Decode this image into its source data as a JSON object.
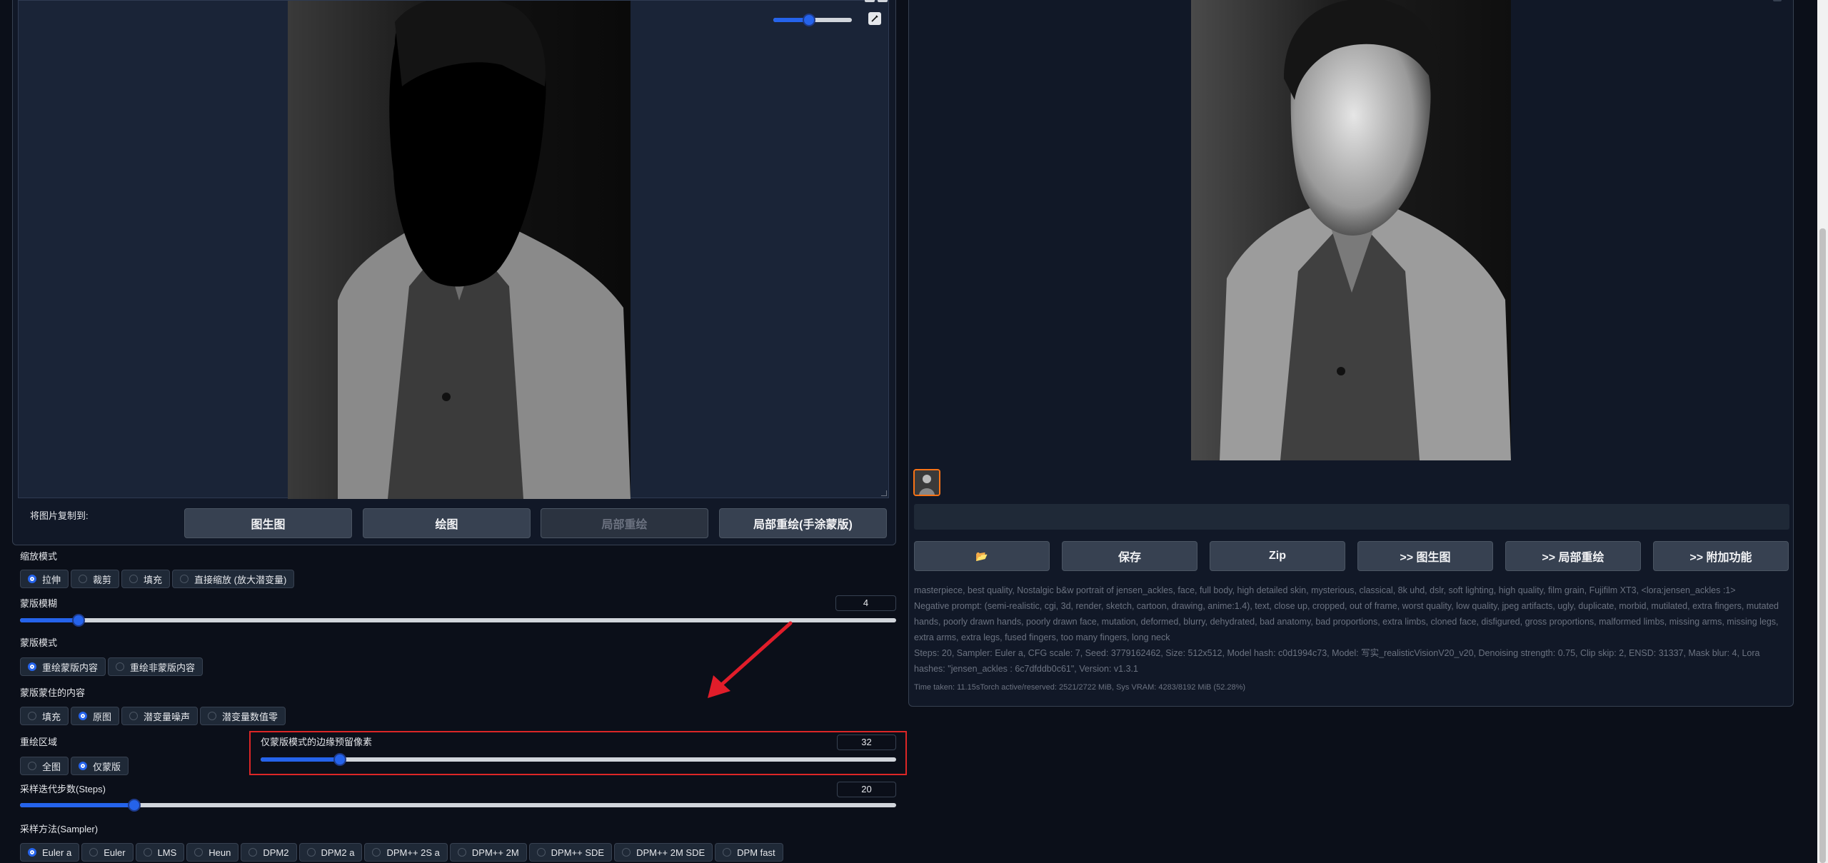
{
  "left": {
    "copy_to_label": "将图片复制到:",
    "copy_buttons": [
      "图生图",
      "绘图",
      "局部重绘",
      "局部重绘(手涂蒙版)"
    ],
    "resize_mode": {
      "label": "缩放模式",
      "options": [
        "拉伸",
        "裁剪",
        "填充",
        "直接缩放 (放大潜变量)"
      ],
      "selected": "拉伸"
    },
    "mask_blur": {
      "label": "蒙版模糊",
      "value": "4",
      "fraction": 0.067
    },
    "mask_mode": {
      "label": "蒙版模式",
      "options": [
        "重绘蒙版内容",
        "重绘非蒙版内容"
      ],
      "selected": "重绘蒙版内容"
    },
    "masked_content": {
      "label": "蒙版蒙住的内容",
      "options": [
        "填充",
        "原图",
        "潜变量噪声",
        "潜变量数值零"
      ],
      "selected": "原图"
    },
    "inpaint_area": {
      "label": "重绘区域",
      "options": [
        "全图",
        "仅蒙版"
      ],
      "selected": "仅蒙版"
    },
    "only_masked_padding": {
      "label": "仅蒙版模式的边缘预留像素",
      "value": "32",
      "fraction": 0.125
    },
    "steps": {
      "label": "采样迭代步数(Steps)",
      "value": "20",
      "fraction": 0.13
    },
    "sampler": {
      "label": "采样方法(Sampler)",
      "options": [
        "Euler a",
        "Euler",
        "LMS",
        "Heun",
        "DPM2",
        "DPM2 a",
        "DPM++ 2S a",
        "DPM++ 2M",
        "DPM++ SDE",
        "DPM++ 2M SDE",
        "DPM fast"
      ],
      "selected": "Euler a"
    },
    "brush_size_fraction": 0.45
  },
  "right": {
    "action_buttons": [
      "📂",
      "保存",
      "Zip",
      ">> 图生图",
      ">> 局部重绘",
      ">> 附加功能"
    ],
    "prompt": "masterpiece, best quality, Nostalgic b&w portrait of jensen_ackles, face, full body, high detailed skin, mysterious, classical, 8k uhd, dslr, soft lighting, high quality, film grain, Fujifilm XT3, <lora:jensen_ackles :1>",
    "negative_prompt": "Negative prompt: (semi-realistic, cgi, 3d, render, sketch, cartoon, drawing, anime:1.4), text, close up, cropped, out of frame, worst quality, low quality, jpeg artifacts, ugly, duplicate, morbid, mutilated, extra fingers, mutated hands, poorly drawn hands, poorly drawn face, mutation, deformed, blurry, dehydrated, bad anatomy, bad proportions, extra limbs, cloned face, disfigured, gross proportions, malformed limbs, missing arms, missing legs, extra arms, extra legs, fused fingers, too many fingers, long neck",
    "params": "Steps: 20, Sampler: Euler a, CFG scale: 7, Seed: 3779162462, Size: 512x512, Model hash: c0d1994c73, Model: 写实_realisticVisionV20_v20, Denoising strength: 0.75, Clip skip: 2, ENSD: 31337, Mask blur: 4, Lora hashes: \"jensen_ackles : 6c7dfddb0c61\", Version: v1.3.1",
    "time_taken": "Time taken: 11.15sTorch active/reserved: 2521/2722 MiB, Sys VRAM: 4283/8192 MiB (52.28%)"
  },
  "colors": {
    "accent": "#2563eb",
    "highlight_box": "#dc2626",
    "arrow": "#e11d2a",
    "thumb_border": "#f97316"
  }
}
